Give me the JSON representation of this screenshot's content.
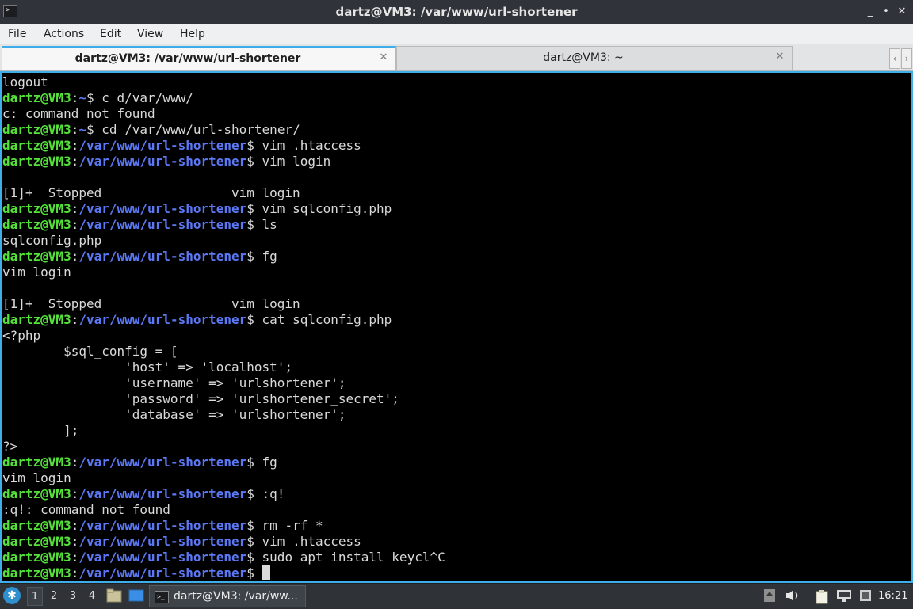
{
  "window": {
    "title": "dartz@VM3: /var/www/url-shortener",
    "controls": {
      "minimize": "_",
      "maximize": "•",
      "restore": "^",
      "close": "✕"
    }
  },
  "menu": [
    "File",
    "Actions",
    "Edit",
    "View",
    "Help"
  ],
  "tabs": [
    {
      "label": "dartz@VM3: /var/www/url-shortener",
      "active": true
    },
    {
      "label": "dartz@VM3: ~",
      "active": false
    }
  ],
  "terminal": {
    "prompt_user": "dartz@VM3",
    "lines": [
      {
        "text": "logout"
      },
      {
        "prompt": true,
        "path": "~",
        "cmd": " c d/var/www/"
      },
      {
        "text": "c: command not found"
      },
      {
        "prompt": true,
        "path": "~",
        "cmd": " cd /var/www/url-shortener/"
      },
      {
        "prompt": true,
        "path": "/var/www/url-shortener",
        "cmd": " vim .htaccess"
      },
      {
        "prompt": true,
        "path": "/var/www/url-shortener",
        "cmd": " vim login"
      },
      {
        "text": ""
      },
      {
        "text": "[1]+  Stopped                 vim login"
      },
      {
        "prompt": true,
        "path": "/var/www/url-shortener",
        "cmd": " vim sqlconfig.php"
      },
      {
        "prompt": true,
        "path": "/var/www/url-shortener",
        "cmd": " ls"
      },
      {
        "text": "sqlconfig.php"
      },
      {
        "prompt": true,
        "path": "/var/www/url-shortener",
        "cmd": " fg"
      },
      {
        "text": "vim login"
      },
      {
        "text": ""
      },
      {
        "text": "[1]+  Stopped                 vim login"
      },
      {
        "prompt": true,
        "path": "/var/www/url-shortener",
        "cmd": " cat sqlconfig.php"
      },
      {
        "text": "<?php"
      },
      {
        "text": "        $sql_config = ["
      },
      {
        "text": "                'host' => 'localhost';"
      },
      {
        "text": "                'username' => 'urlshortener';"
      },
      {
        "text": "                'password' => 'urlshortener_secret';"
      },
      {
        "text": "                'database' => 'urlshortener';"
      },
      {
        "text": "        ];"
      },
      {
        "text": "?>"
      },
      {
        "prompt": true,
        "path": "/var/www/url-shortener",
        "cmd": " fg"
      },
      {
        "text": "vim login"
      },
      {
        "prompt": true,
        "path": "/var/www/url-shortener",
        "cmd": " :q!"
      },
      {
        "text": ":q!: command not found"
      },
      {
        "prompt": true,
        "path": "/var/www/url-shortener",
        "cmd": " rm -rf *"
      },
      {
        "prompt": true,
        "path": "/var/www/url-shortener",
        "cmd": " vim .htaccess"
      },
      {
        "prompt": true,
        "path": "/var/www/url-shortener",
        "cmd": " sudo apt install keycl^C"
      },
      {
        "prompt": true,
        "path": "/var/www/url-shortener",
        "cmd": " ",
        "cursor": true
      }
    ]
  },
  "taskbar": {
    "workspaces": [
      "1",
      "2",
      "3",
      "4"
    ],
    "active_workspace": "1",
    "task_label": "dartz@VM3: /var/ww...",
    "clock": "16:21"
  },
  "colors": {
    "accent": "#3daee9",
    "prompt_user": "#54e13a",
    "prompt_path": "#5b78f5",
    "terminal_bg": "#000000",
    "terminal_fg": "#dadada"
  }
}
